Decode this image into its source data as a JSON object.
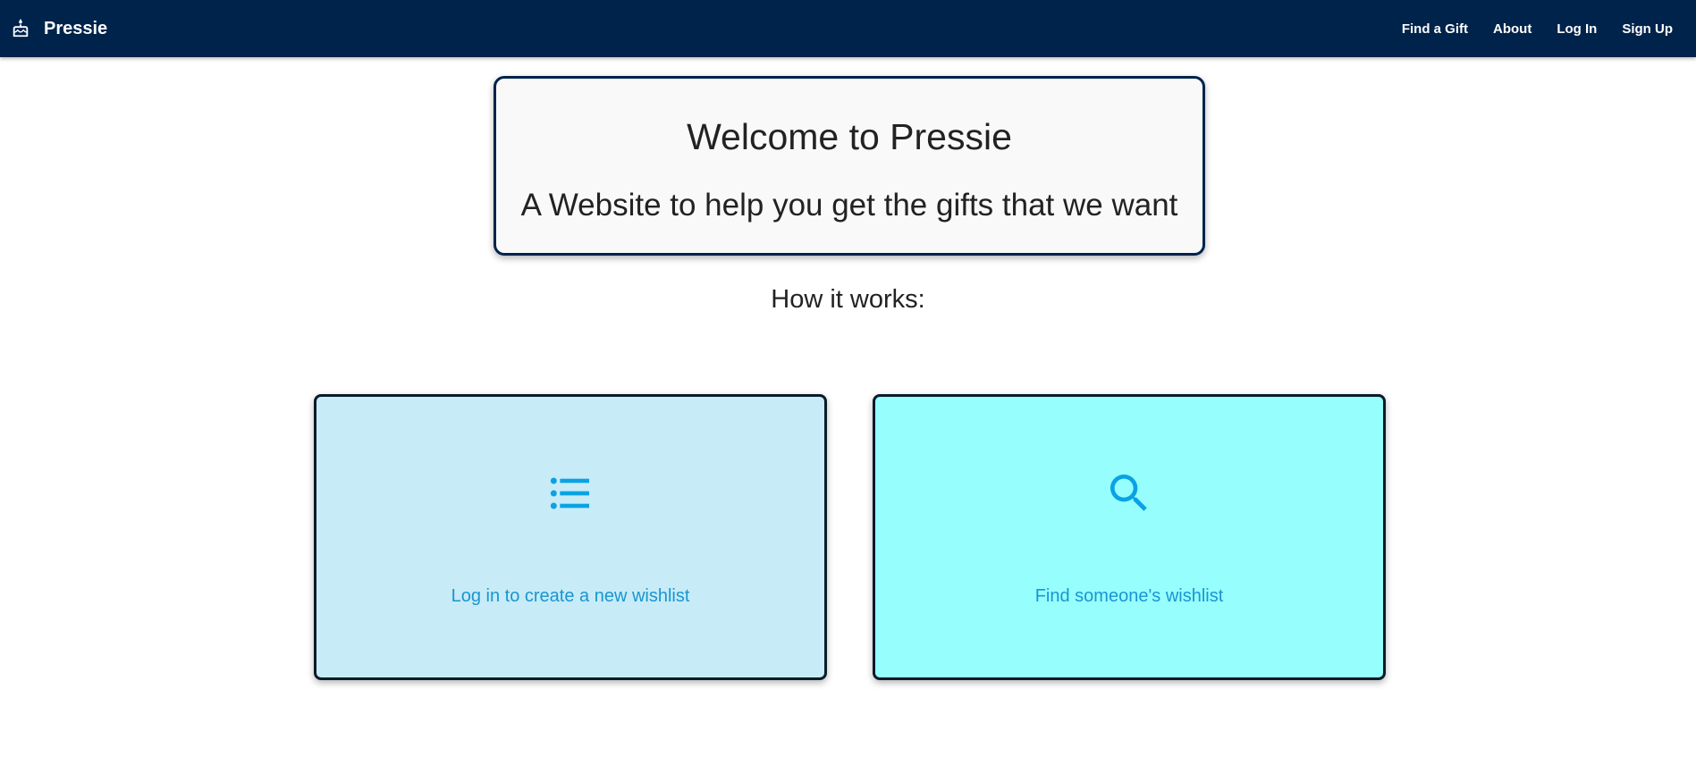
{
  "navbar": {
    "brand": "Pressie",
    "brand_icon": "cake-icon",
    "links": [
      "Find a Gift",
      "About",
      "Log In",
      "Sign Up"
    ]
  },
  "hero": {
    "title": "Welcome to Pressie",
    "subtitle": "A Website to help you get the gifts that we want"
  },
  "section": {
    "heading": "How it works:"
  },
  "cards": [
    {
      "icon": "list-icon",
      "label": "Log in to create a new wishlist",
      "background": "#c7ecf7"
    },
    {
      "icon": "search-icon",
      "label": "Find someone's wishlist",
      "background": "#96fffe"
    }
  ],
  "colors": {
    "navbar": "#00234b",
    "accent": "#1a95d0",
    "icon": "#0aa2e4"
  }
}
